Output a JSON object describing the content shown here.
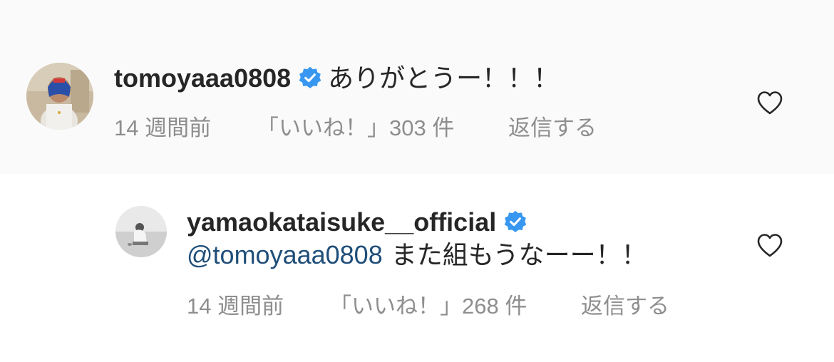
{
  "comments": [
    {
      "username": "tomoyaaa0808",
      "verified": true,
      "mention": "",
      "text": "ありがとうー！！！",
      "time": "14 週間前",
      "likes": "「いいね！」303 件",
      "reply": "返信する",
      "avatar_icon": "profile-photo-boxer"
    },
    {
      "username": "yamaokataisuke__official",
      "verified": true,
      "mention": "@tomoyaaa0808",
      "text": "また組もうなーー！！",
      "time": "14 週間前",
      "likes": "「いいね！」268 件",
      "reply": "返信する",
      "avatar_icon": "profile-photo-baseball"
    }
  ],
  "colors": {
    "verified_badge": "#3897f0",
    "mention": "#1f4e79",
    "meta_text": "#8e8e8e",
    "highlight_bg": "#fafafa"
  }
}
